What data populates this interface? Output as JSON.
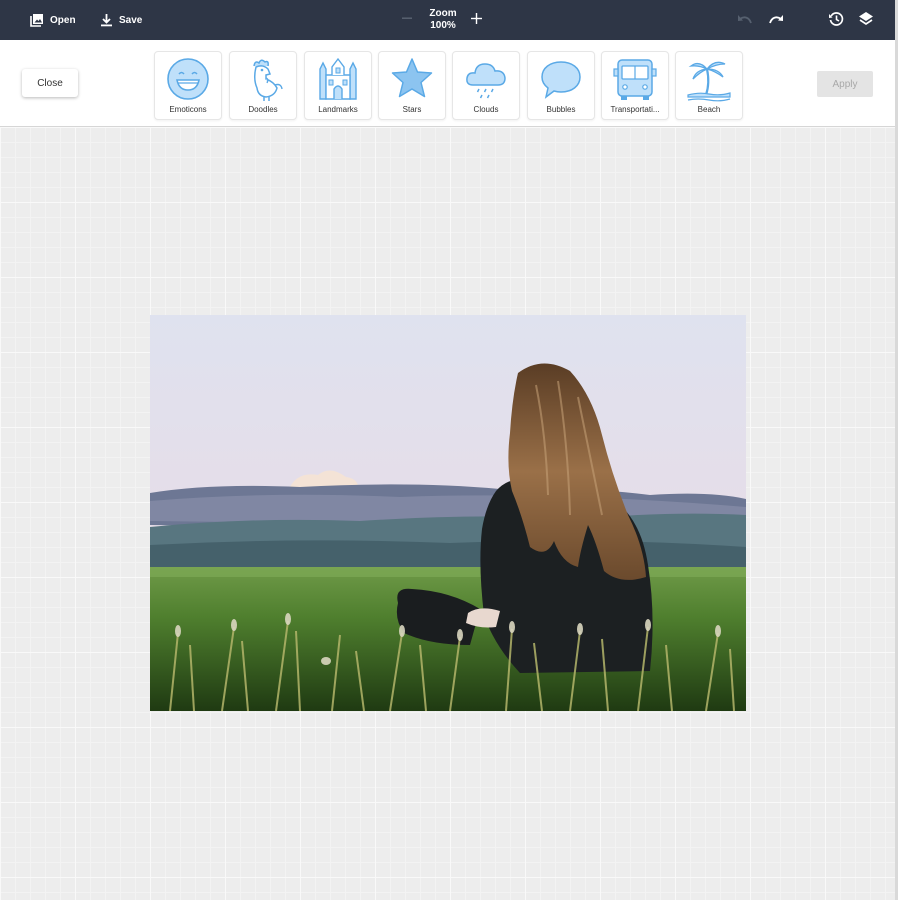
{
  "topbar": {
    "open_label": "Open",
    "save_label": "Save",
    "zoom_title": "Zoom",
    "zoom_value": "100%",
    "icons": [
      "image-icon",
      "download-icon",
      "minus-icon",
      "plus-icon",
      "undo-icon",
      "redo-icon",
      "history-icon",
      "layers-icon"
    ]
  },
  "sticker_toolbar": {
    "close_label": "Close",
    "apply_label": "Apply",
    "categories": [
      {
        "label": "Emoticons",
        "icon": "emoticon-icon"
      },
      {
        "label": "Doodles",
        "icon": "rooster-icon"
      },
      {
        "label": "Landmarks",
        "icon": "castle-icon"
      },
      {
        "label": "Stars",
        "icon": "star-icon"
      },
      {
        "label": "Clouds",
        "icon": "cloud-icon"
      },
      {
        "label": "Bubbles",
        "icon": "speech-bubble-icon"
      },
      {
        "label": "Transportati...",
        "icon": "bus-icon"
      },
      {
        "label": "Beach",
        "icon": "palm-tree-icon"
      }
    ]
  },
  "colors": {
    "topbar_bg": "#2e3646",
    "icon_stroke": "#5aa9e6",
    "icon_fill": "#bfe0fa",
    "canvas_bg": "#ededed"
  }
}
